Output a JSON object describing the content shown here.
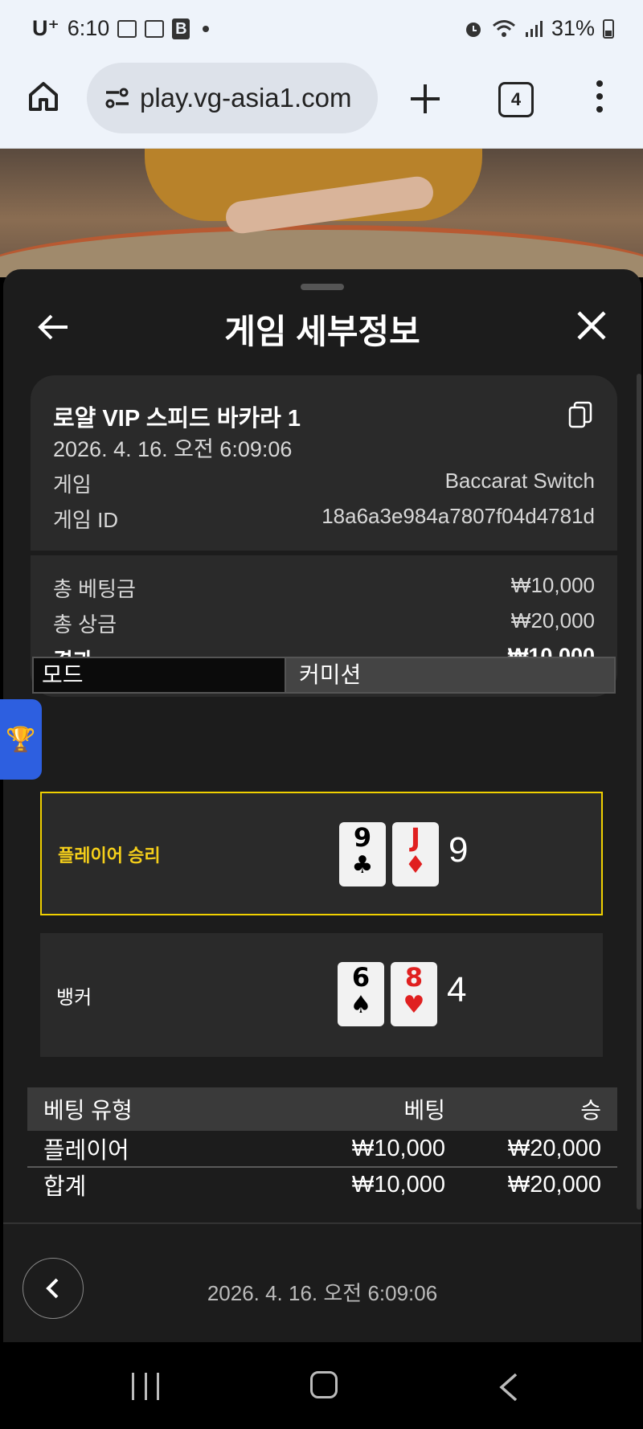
{
  "status_bar": {
    "carrier": "U⁺",
    "time": "6:10",
    "battery": "31%"
  },
  "browser": {
    "url": "play.vg-asia1.com",
    "tab_count": "4"
  },
  "sheet": {
    "title": "게임 세부정보",
    "game_name": "로얄 VIP 스피드 바카라 1",
    "datetime": "2026. 4. 16. 오전 6:09:06",
    "game_label": "게임",
    "game_value": "Baccarat Switch",
    "game_id_label": "게임 ID",
    "game_id_value": "18a6a3e984a7807f04d4781d",
    "total_bet_label": "총 베팅금",
    "total_bet_value": "₩10,000",
    "total_prize_label": "총 상금",
    "total_prize_value": "₩20,000",
    "result_label": "결과",
    "result_value": "₩10,000"
  },
  "tabs": {
    "mode": "모드",
    "commission": "커미션"
  },
  "results": {
    "player": {
      "label": "플레이어 승리",
      "cards": [
        {
          "rank": "9",
          "suit": "♣"
        },
        {
          "rank": "J",
          "suit": "♦"
        }
      ],
      "score": "9"
    },
    "banker": {
      "label": "뱅커",
      "cards": [
        {
          "rank": "6",
          "suit": "♠"
        },
        {
          "rank": "8",
          "suit": "♥"
        }
      ],
      "score": "4"
    }
  },
  "bet_table": {
    "headers": [
      "베팅 유형",
      "베팅",
      "승"
    ],
    "rows": [
      {
        "type": "플레이어",
        "bet": "₩10,000",
        "win": "₩20,000"
      }
    ],
    "total": {
      "type": "합계",
      "bet": "₩10,000",
      "win": "₩20,000"
    }
  },
  "footer": {
    "datetime": "2026. 4. 16. 오전 6:09:06"
  },
  "colors": {
    "win_border": "#f0d000",
    "win_label": "#f5cf1a",
    "sheet_bg": "#1c1c1c",
    "card_bg": "#2a2a2a"
  }
}
